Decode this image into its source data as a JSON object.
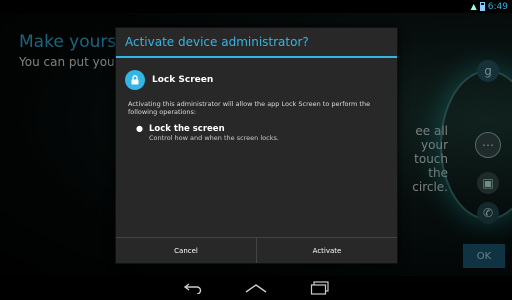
{
  "background": {
    "title": "Make yourself",
    "subtitle": "You can put your fa",
    "side_text": "ee all your touch the circle.",
    "ok_label": "OK"
  },
  "status_bar": {
    "time": "6:49"
  },
  "dialog": {
    "title": "Activate device administrator?",
    "admin_name": "Lock Screen",
    "description": "Activating this administrator will allow the app Lock Screen to perform the following operations:",
    "policy_title": "Lock the screen",
    "policy_desc": "Control how and when the screen locks.",
    "cancel_label": "Cancel",
    "activate_label": "Activate"
  },
  "colors": {
    "accent": "#33b5e5",
    "dialog_bg": "#282828"
  }
}
